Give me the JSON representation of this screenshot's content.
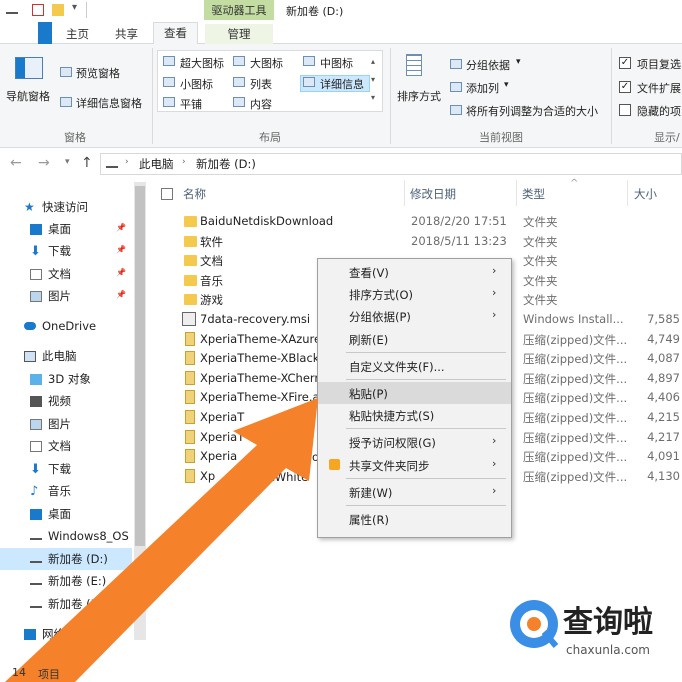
{
  "window": {
    "title": "新加卷 (D:)",
    "context_tab_group": "驱动器工具"
  },
  "ribbon_tabs": [
    {
      "label": "主页",
      "active": false
    },
    {
      "label": "共享",
      "active": false
    },
    {
      "label": "查看",
      "active": true
    },
    {
      "label": "管理",
      "active": false
    }
  ],
  "ribbon": {
    "panes": {
      "nav_pane": "导航窗格",
      "preview_pane": "预览窗格",
      "details_pane": "详细信息窗格",
      "group_label": "窗格"
    },
    "layout": {
      "items": [
        "超大图标",
        "大图标",
        "中图标",
        "小图标",
        "列表",
        "详细信息",
        "平铺",
        "内容"
      ],
      "selected": "详细信息",
      "group_label": "布局"
    },
    "current_view": {
      "sort_by": "排序方式",
      "group_by": "分组依据",
      "add_column": "添加列",
      "fit_columns": "将所有列调整为合适的大小",
      "group_label": "当前视图"
    },
    "show_hide": {
      "item_checkboxes": {
        "label": "项目复选",
        "checked": true
      },
      "file_extensions": {
        "label": "文件扩展",
        "checked": true
      },
      "hidden_items": {
        "label": "隐藏的项",
        "checked": false
      },
      "group_label": "显示/"
    }
  },
  "address": {
    "path": [
      "此电脑",
      "新加卷 (D:)"
    ]
  },
  "nav": {
    "quick_access": "快速访问",
    "quick_items": [
      "桌面",
      "下载",
      "文档",
      "图片"
    ],
    "onedrive": "OneDrive",
    "this_pc": "此电脑",
    "pc_items": [
      "3D 对象",
      "视频",
      "图片",
      "文档",
      "下载",
      "音乐",
      "桌面",
      "Windows8_OS",
      "新加卷 (D:)",
      "新加卷 (E:)",
      "新加卷 (F"
    ],
    "selected": "新加卷 (D:)",
    "network": "网络"
  },
  "columns": {
    "name": "名称",
    "date": "修改日期",
    "type": "类型",
    "size": "大小"
  },
  "files": [
    {
      "name": "BaiduNetdiskDownload",
      "date": "2018/2/20 17:51",
      "type": "文件夹",
      "size": "",
      "kind": "folder"
    },
    {
      "name": "软件",
      "date": "2018/5/11 13:23",
      "type": "文件夹",
      "size": "",
      "kind": "folder"
    },
    {
      "name": "文档",
      "date": "",
      "type": "文件夹",
      "size": "",
      "kind": "folder"
    },
    {
      "name": "音乐",
      "date": "",
      "type": "文件夹",
      "size": "",
      "kind": "folder"
    },
    {
      "name": "游戏",
      "date": "",
      "type": "文件夹",
      "size": "",
      "kind": "folder"
    },
    {
      "name": "7data-recovery.msi",
      "date": "",
      "type": "Windows Install...",
      "size": "7,585",
      "kind": "msi"
    },
    {
      "name": "XperiaTheme-XAzure",
      "date": "",
      "type": "压缩(zipped)文件...",
      "size": "4,749",
      "kind": "zip"
    },
    {
      "name": "XperiaTheme-XBlack.",
      "date": "",
      "type": "压缩(zipped)文件...",
      "size": "4,087",
      "kind": "zip"
    },
    {
      "name": "XperiaTheme-XCherry",
      "date": "",
      "type": "压缩(zipped)文件...",
      "size": "4,897",
      "kind": "zip"
    },
    {
      "name": "XperiaTheme-XFire.ap",
      "date": "",
      "type": "压缩(zipped)文件...",
      "size": "4,406",
      "kind": "zip"
    },
    {
      "name": "XperiaT",
      "date": "",
      "type": "压缩(zipped)文件...",
      "size": "4,215",
      "kind": "zip"
    },
    {
      "name": "XperiaT",
      "date": "",
      "type": "压缩(zipped)文件...",
      "size": "4,217",
      "kind": "zip"
    },
    {
      "name": "Xperia",
      "date": "",
      "type": "压缩(zipped)文件...",
      "size": "4,091",
      "kind": "zip"
    },
    {
      "name": "Xp",
      "date": "",
      "type": "压缩(zipped)文件...",
      "size": "4,130",
      "kind": "zip"
    }
  ],
  "context_menu": [
    {
      "label": "查看(V)",
      "submenu": true
    },
    {
      "label": "排序方式(O)",
      "submenu": true
    },
    {
      "label": "分组依据(P)",
      "submenu": true
    },
    {
      "label": "刷新(E)",
      "submenu": false
    },
    {
      "sep": true
    },
    {
      "label": "自定义文件夹(F)...",
      "submenu": false
    },
    {
      "sep": true
    },
    {
      "label": "粘贴(P)",
      "submenu": false,
      "highlight": true
    },
    {
      "label": "粘贴快捷方式(S)",
      "submenu": false
    },
    {
      "sep": true
    },
    {
      "label": "授予访问权限(G)",
      "submenu": true
    },
    {
      "label": "共享文件夹同步",
      "submenu": true,
      "icon": "sync-icon"
    },
    {
      "sep": true
    },
    {
      "label": "新建(W)",
      "submenu": true
    },
    {
      "sep": true
    },
    {
      "label": "属性(R)",
      "submenu": false
    }
  ],
  "partial_overlay_text": {
    "ose": "ose.",
    "me_white": "me-XWhite"
  },
  "status": {
    "count": "14",
    "unit": "项目"
  },
  "watermark": {
    "text": "查询啦",
    "url": "chaxunla.com"
  },
  "colors": {
    "accent_blue": "#1979ca",
    "selection": "#cce8ff",
    "arrow": "#f5822a",
    "drive_tools": "#c3dca2"
  }
}
